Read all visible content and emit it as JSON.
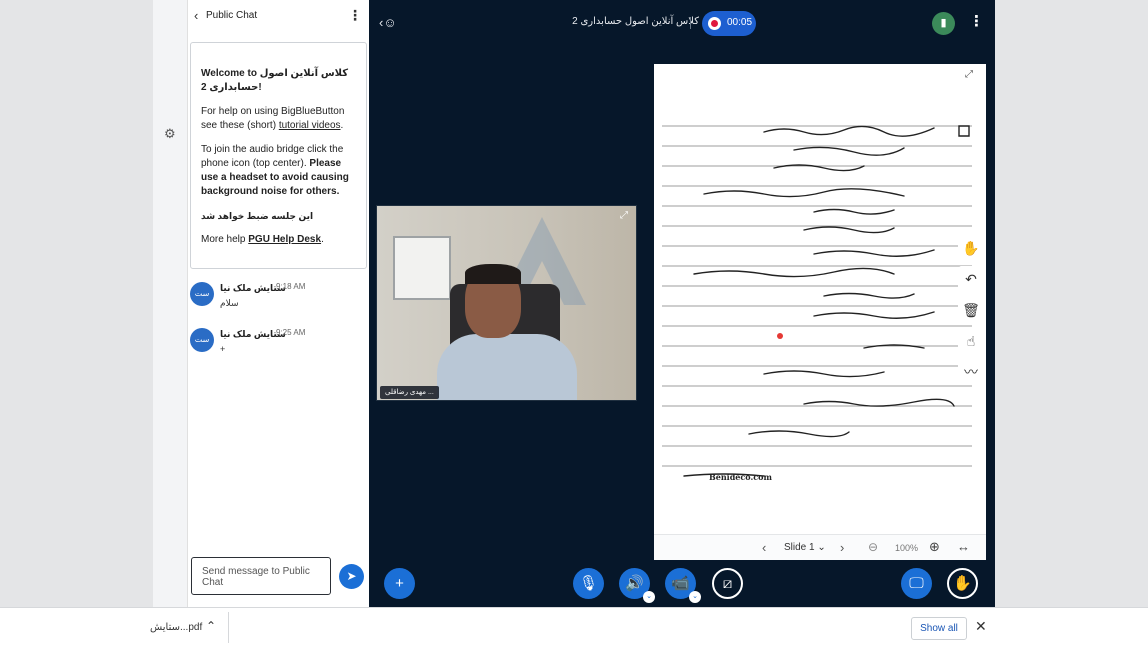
{
  "chat": {
    "header_title": "Public Chat",
    "welcome": {
      "line1_prefix": "Welcome to ",
      "class_name": "کلاس آنلاین اصول حسابداری 2",
      "line1_suffix": "!",
      "help_prefix": "For help on using BigBlueButton see these (short) ",
      "help_link": "tutorial videos",
      "help_suffix": ".",
      "audio_prefix": "To join the audio bridge click the phone icon (top center). ",
      "audio_bold": "Please use a headset to avoid causing background noise for others.",
      "recording_note": "این جلسه ضبط خواهد شد",
      "more_help_prefix": "More help ",
      "more_help_link": "PGU Help Desk",
      "more_help_suffix": "."
    },
    "messages": [
      {
        "avatar": "ست",
        "name": "ستایش ملک نیا",
        "time": "9:18 AM",
        "text": "سلام"
      },
      {
        "avatar": "ست",
        "name": "ستایش ملک نیا",
        "time": "9:25 AM",
        "text": "+"
      }
    ],
    "input_placeholder": "Send message to Public Chat"
  },
  "topbar": {
    "meeting_title": "کلاس آنلاین اصول حسابداری 2",
    "recording_timer": "00:05"
  },
  "webcam": {
    "user_label": "مهدی رضاقلی ..."
  },
  "presentation": {
    "slide_label": "Slide 1",
    "zoom": "100%",
    "watermark": "Benideco.com"
  },
  "shelf": {
    "file_name": "ستایش...pdf",
    "show_all": "Show all"
  },
  "colors": {
    "main_bg": "#06172a",
    "accent_blue": "#1b6fd6",
    "record_red": "#e0193e",
    "connection_green": "#3b8a5a"
  }
}
